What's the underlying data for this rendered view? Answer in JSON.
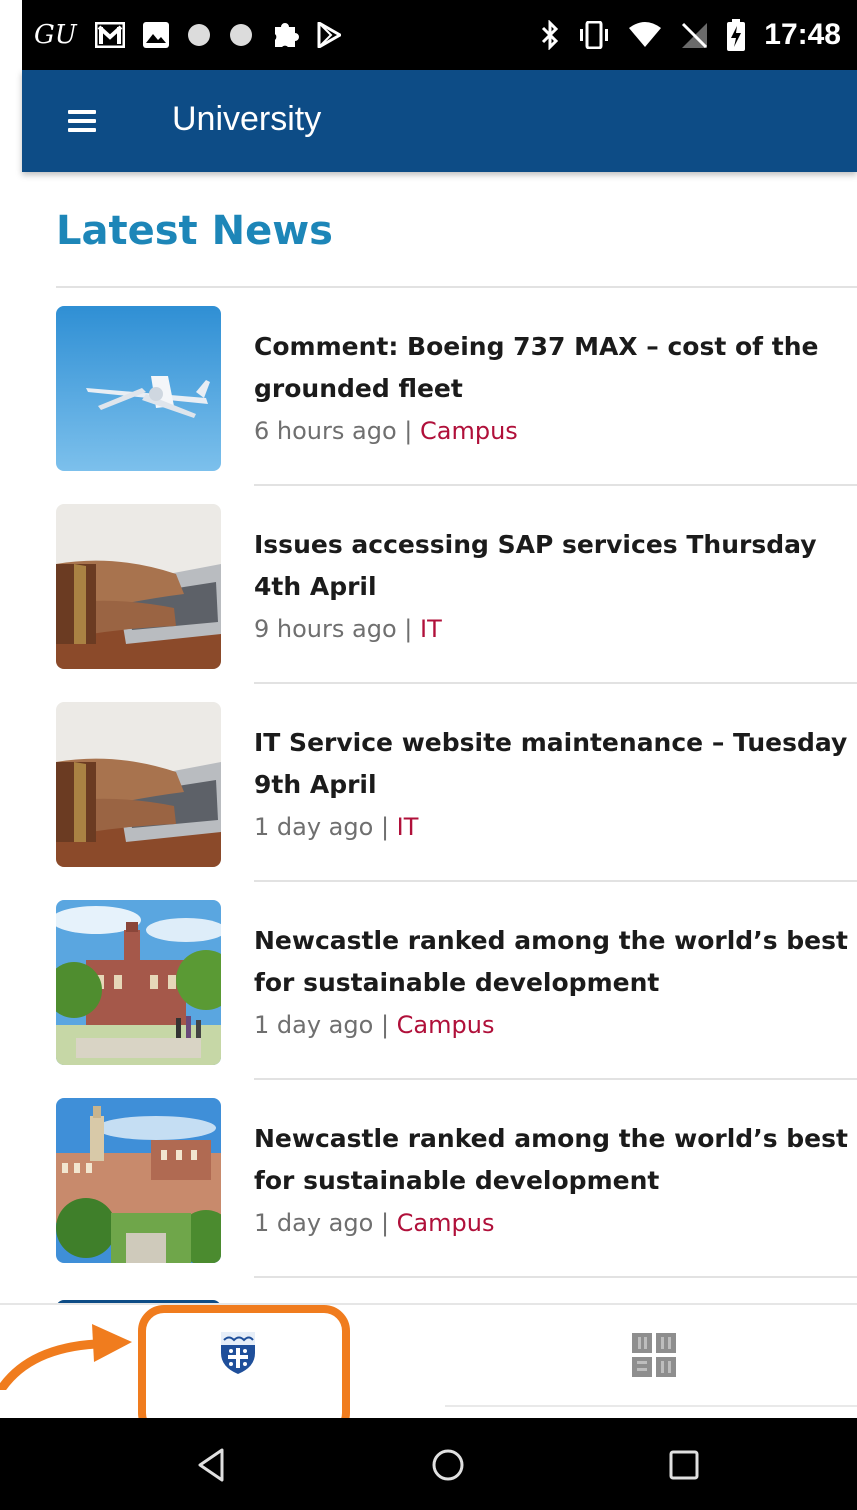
{
  "status_bar": {
    "left_text": "GU",
    "time": "17:48",
    "icons_left": [
      "gu-icon",
      "gmail-icon",
      "image-icon",
      "dot-icon",
      "dot-icon",
      "puzzle-icon",
      "play-store-icon"
    ],
    "icons_right": [
      "bluetooth-icon",
      "vibrate-icon",
      "wifi-icon",
      "no-signal-icon",
      "battery-charging-icon"
    ]
  },
  "app_bar": {
    "title": "University",
    "menu_icon": "hamburger-menu-icon",
    "color": "#0d4c86"
  },
  "section": {
    "title": "Latest News",
    "title_color": "#1d86b8"
  },
  "news": [
    {
      "title": "Comment: Boeing 737 MAX – cost of the grounded fleet",
      "time": "6 hours ago",
      "separator": "|",
      "category": "Campus",
      "thumbnail": "airplane-photo"
    },
    {
      "title": "Issues accessing SAP services Thursday 4th April",
      "time": "9 hours ago",
      "separator": "|",
      "category": "IT",
      "thumbnail": "laptop-typing-photo"
    },
    {
      "title": "IT Service website maintenance – Tuesday 9th April",
      "time": "1 day ago",
      "separator": "|",
      "category": "IT",
      "thumbnail": "laptop-typing-photo"
    },
    {
      "title": "Newcastle ranked among the world’s best for sustainable development",
      "time": "1 day ago",
      "separator": "|",
      "category": "Campus",
      "thumbnail": "campus-building-photo"
    },
    {
      "title": "Newcastle ranked among the world’s best for sustainable development",
      "time": "1 day ago",
      "separator": "|",
      "category": "Campus",
      "thumbnail": "campus-aerial-photo"
    }
  ],
  "category_color": "#b0103a",
  "bottom_nav": {
    "tabs": [
      {
        "icon": "university-crest-icon",
        "selected": true
      },
      {
        "icon": "nusu-logo-icon",
        "selected": false
      }
    ],
    "highlight_color": "#f07c1e"
  },
  "system_nav": {
    "buttons": [
      "back-icon",
      "home-icon",
      "recents-icon"
    ]
  }
}
